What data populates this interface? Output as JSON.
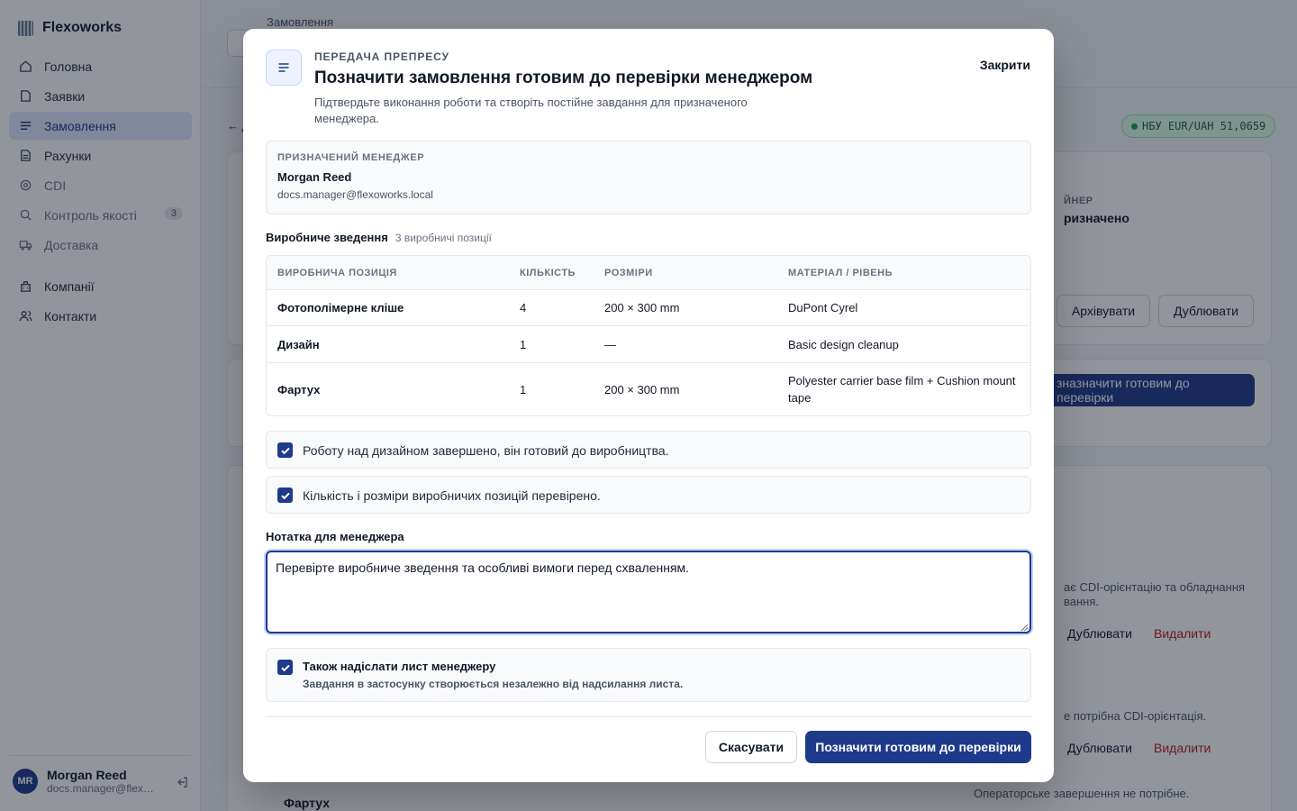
{
  "app": {
    "name": "Flexoworks"
  },
  "sidebar": {
    "items": [
      {
        "label": "Головна",
        "icon": "home-icon"
      },
      {
        "label": "Заявки",
        "icon": "file-icon"
      },
      {
        "label": "Замовлення",
        "icon": "list-icon",
        "active": true
      },
      {
        "label": "Рахунки",
        "icon": "document-icon"
      },
      {
        "label": "CDI",
        "icon": "target-icon"
      },
      {
        "label": "Контроль якості",
        "icon": "search-icon",
        "badge": "3"
      },
      {
        "label": "Доставка",
        "icon": "truck-icon"
      },
      {
        "label": "Компанії",
        "icon": "building-icon"
      },
      {
        "label": "Контакти",
        "icon": "users-icon"
      }
    ],
    "user": {
      "initials": "MR",
      "name": "Morgan Reed",
      "email": "docs.manager@flexoworks.local"
    }
  },
  "background": {
    "breadcrumb": "Замовлення",
    "back_link": "← Д",
    "rate_badge": "НБУ EUR/UAH 51,0659",
    "designer_label": "ЙНЕР",
    "designer_value": "ризначено",
    "archive_button": "Архівувати",
    "duplicate_button": "Дублювати",
    "mark_ready_button": "зназначити готовим до перевірки",
    "row1_note": "ає CDI-орієнтацію та обладнання",
    "row1_note2": "вання.",
    "row_duplicate": "Дублювати",
    "row_delete": "Видалити",
    "row2_note": "е потрібна CDI-орієнтація.",
    "row3_title": "Фартух",
    "row3_note": "Операторське завершення не потрібне."
  },
  "modal": {
    "eyebrow": "ПЕРЕДАЧА ПРЕПРЕСУ",
    "title": "Позначити замовлення готовим до перевірки менеджером",
    "subtitle": "Підтвердьте виконання роботи та створіть постійне завдання для призначеного менеджера.",
    "close": "Закрити",
    "manager": {
      "label": "ПРИЗНАЧЕНИЙ МЕНЕДЖЕР",
      "name": "Morgan Reed",
      "email": "docs.manager@flexoworks.local"
    },
    "summary": {
      "title": "Виробниче зведення",
      "count": "3 виробничі позиції",
      "columns": [
        "ВИРОБНИЧА ПОЗИЦІЯ",
        "КІЛЬКІСТЬ",
        "РОЗМІРИ",
        "МАТЕРІАЛ / РІВЕНЬ"
      ],
      "rows": [
        {
          "item": "Фотополімерне кліше",
          "qty": "4",
          "size": "200 × 300 mm",
          "material": "DuPont Cyrel"
        },
        {
          "item": "Дизайн",
          "qty": "1",
          "size": "—",
          "material": "Basic design cleanup"
        },
        {
          "item": "Фартух",
          "qty": "1",
          "size": "200 × 300 mm",
          "material": "Polyester carrier base film + Cushion mount tape"
        }
      ]
    },
    "checks": [
      {
        "label": "Роботу над дизайном завершено, він готовий до виробництва.",
        "checked": true
      },
      {
        "label": "Кількість і розміри виробничих позицій перевірено.",
        "checked": true
      }
    ],
    "note": {
      "label": "Нотатка для менеджера",
      "value": "Перевірте виробниче зведення та особливі вимоги перед схваленням."
    },
    "email": {
      "label": "Також надіслати лист менеджеру",
      "hint": "Завдання в застосунку створюється незалежно від надсилання листа.",
      "checked": true
    },
    "cancel": "Скасувати",
    "confirm": "Позначити готовим до перевірки"
  },
  "colors": {
    "primary": "#1e3a8a",
    "danger": "#b91c1c",
    "success": "#16a34a"
  }
}
